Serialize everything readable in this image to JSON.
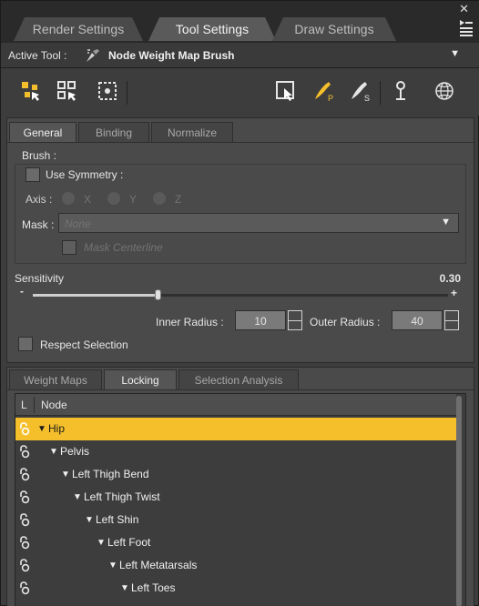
{
  "tabs": {
    "render": "Render Settings",
    "tool": "Tool Settings",
    "draw": "Draw Settings"
  },
  "active_tool": {
    "label": "Active Tool :",
    "value": "Node Weight Map Brush"
  },
  "sub_tabs": {
    "general": "General",
    "binding": "Binding",
    "normalize": "Normalize"
  },
  "brush": {
    "label": "Brush :",
    "use_symmetry": "Use Symmetry :",
    "axis_label": "Axis :",
    "axis_x": "X",
    "axis_y": "Y",
    "axis_z": "Z",
    "mask_label": "Mask :",
    "mask_value": "None",
    "mask_centerline": "Mask Centerline"
  },
  "sensitivity": {
    "label": "Sensitivity",
    "value": "0.30",
    "min_sign": "-",
    "max_sign": "+",
    "level": 0.3
  },
  "radius": {
    "inner_label": "Inner Radius :",
    "inner_value": "10",
    "outer_label": "Outer Radius :",
    "outer_value": "40"
  },
  "respect_selection": "Respect Selection",
  "lower_tabs": {
    "weight_maps": "Weight Maps",
    "locking": "Locking",
    "selection_analysis": "Selection Analysis"
  },
  "tree": {
    "col_l": "L",
    "col_node": "Node",
    "rows": [
      {
        "label": "Hip",
        "depth": 0,
        "selected": true
      },
      {
        "label": "Pelvis",
        "depth": 1
      },
      {
        "label": "Left Thigh Bend",
        "depth": 2
      },
      {
        "label": "Left Thigh Twist",
        "depth": 3
      },
      {
        "label": "Left Shin",
        "depth": 4
      },
      {
        "label": "Left Foot",
        "depth": 5
      },
      {
        "label": "Left Metatarsals",
        "depth": 6
      },
      {
        "label": "Left Toes",
        "depth": 7
      }
    ]
  },
  "icons": [
    "node-select-icon",
    "multi-select-icon",
    "node-grid-icon",
    "region-select-icon",
    "paint-brush-p-icon",
    "paint-brush-s-icon",
    "pin-icon",
    "globe-icon"
  ],
  "colors": {
    "accent": "#f5bf2c",
    "panel": "#4a4a4a",
    "bg": "#3d3d3d"
  }
}
